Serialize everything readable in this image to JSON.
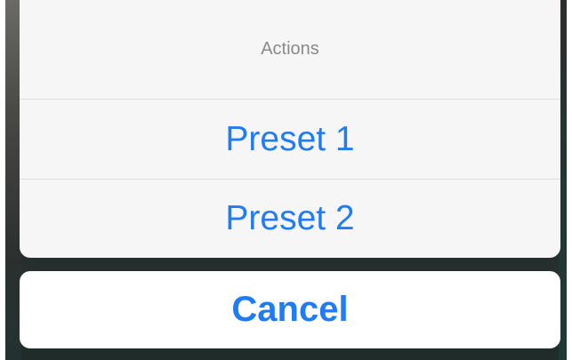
{
  "action_sheet": {
    "title": "Actions",
    "options": [
      {
        "label": "Preset 1"
      },
      {
        "label": "Preset 2"
      }
    ],
    "cancel_label": "Cancel"
  },
  "colors": {
    "accent": "#1f7cf2",
    "title_text": "#8a8a8a",
    "sheet_background": "#f6f6f6",
    "separator": "#dcdcdc"
  }
}
